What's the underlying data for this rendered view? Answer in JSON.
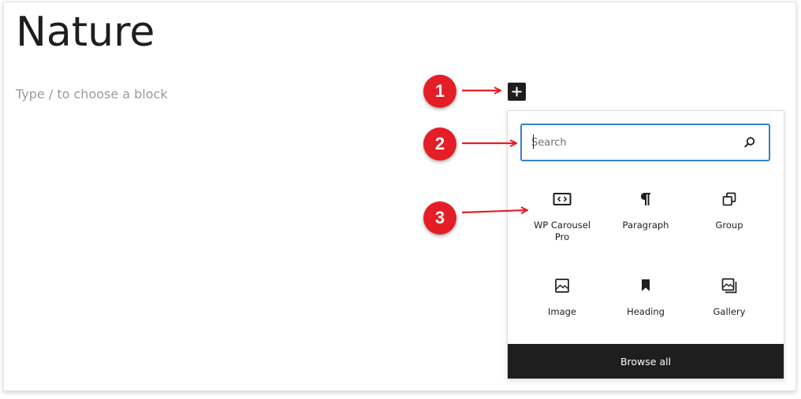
{
  "editor": {
    "post_title": "Nature",
    "block_placeholder": "Type / to choose a block"
  },
  "inserter": {
    "toggle_icon": "plus-icon",
    "search": {
      "placeholder": "Search",
      "icon": "search-icon"
    },
    "blocks": [
      {
        "label": "WP Carousel Pro",
        "icon": "carousel-embed-icon"
      },
      {
        "label": "Paragraph",
        "icon": "paragraph-icon"
      },
      {
        "label": "Group",
        "icon": "group-icon"
      },
      {
        "label": "Image",
        "icon": "image-icon"
      },
      {
        "label": "Heading",
        "icon": "bookmark-icon"
      },
      {
        "label": "Gallery",
        "icon": "gallery-icon"
      }
    ],
    "browse_all_label": "Browse all"
  },
  "annotations": {
    "markers": [
      "1",
      "2",
      "3"
    ],
    "marker_color": "#e41e26"
  },
  "colors": {
    "accent": "#3582c4",
    "dark": "#1e1e1e"
  }
}
